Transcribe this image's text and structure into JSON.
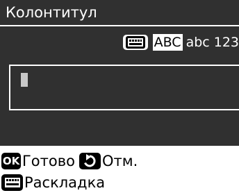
{
  "header": {
    "title": "Колонтитул"
  },
  "input_modes": {
    "upper": "ABC",
    "lower": "abc",
    "numeric": "123"
  },
  "text_field": {
    "value": ""
  },
  "footer": {
    "ok_key": "OK",
    "ok_label": "Готово",
    "back_label": "Отм.",
    "layout_label": "Раскладка"
  },
  "icons": {
    "layout": "keyboard-layout-icon",
    "back": "back-arrow-icon"
  },
  "colors": {
    "panel": "#303030",
    "text_on_dark": "#ffffff",
    "cursor": "#c8c8c8"
  }
}
